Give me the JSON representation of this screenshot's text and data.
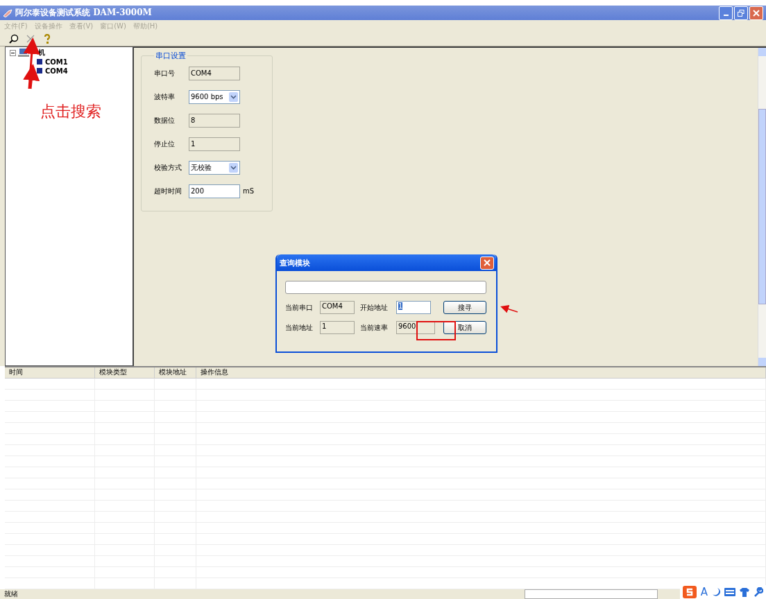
{
  "window": {
    "title": "阿尔泰设备测试系统 DAM-3000M"
  },
  "menu": [
    {
      "label": "文件(F)",
      "disabled": true
    },
    {
      "label": "设备操作",
      "disabled": true
    },
    {
      "label": "查看(V)",
      "disabled": true
    },
    {
      "label": "窗口(W)",
      "disabled": true
    },
    {
      "label": "帮助(H)",
      "disabled": true
    }
  ],
  "toolbar": [
    {
      "kind": "search",
      "disabled": false
    },
    {
      "kind": "stop",
      "disabled": true
    },
    {
      "kind": "help",
      "disabled": false
    }
  ],
  "tree": {
    "label": "机",
    "expanded": true,
    "children": [
      {
        "label": "COM1"
      },
      {
        "label": "COM4"
      }
    ]
  },
  "serial_settings": {
    "title": "串口设置",
    "fields": [
      {
        "label": "串口号",
        "kind": "readonly",
        "value": "COM4"
      },
      {
        "label": "波特率",
        "kind": "dropdown",
        "value": "9600 bps"
      },
      {
        "label": "数据位",
        "kind": "readonly",
        "value": "8"
      },
      {
        "label": "停止位",
        "kind": "readonly",
        "value": "1"
      },
      {
        "label": "校验方式",
        "kind": "dropdown",
        "value": "无校验"
      },
      {
        "label": "超时时间",
        "kind": "input",
        "value": "200",
        "unit": "mS"
      }
    ]
  },
  "dialog": {
    "title": "查询模块",
    "progress": {
      "level": 0
    },
    "fields": [
      {
        "label": "当前串口",
        "kind": "readonly",
        "value": "COM4"
      },
      {
        "label": "开始地址",
        "kind": "input",
        "value": "1",
        "selected": true
      },
      {
        "label": "当前地址",
        "kind": "readonly",
        "value": "1"
      },
      {
        "label": "当前速率",
        "kind": "readonly",
        "value": "9600",
        "selected": false
      }
    ],
    "buttons": [
      "搜寻",
      "取消"
    ]
  },
  "annotation": {
    "caption": "点击搜索"
  },
  "log_table": {
    "columns": [
      "时间",
      "模块类型",
      "模块地址",
      "操作信息"
    ]
  },
  "status_bar": {
    "text": "就绪"
  },
  "ime": {
    "mode": "A"
  }
}
